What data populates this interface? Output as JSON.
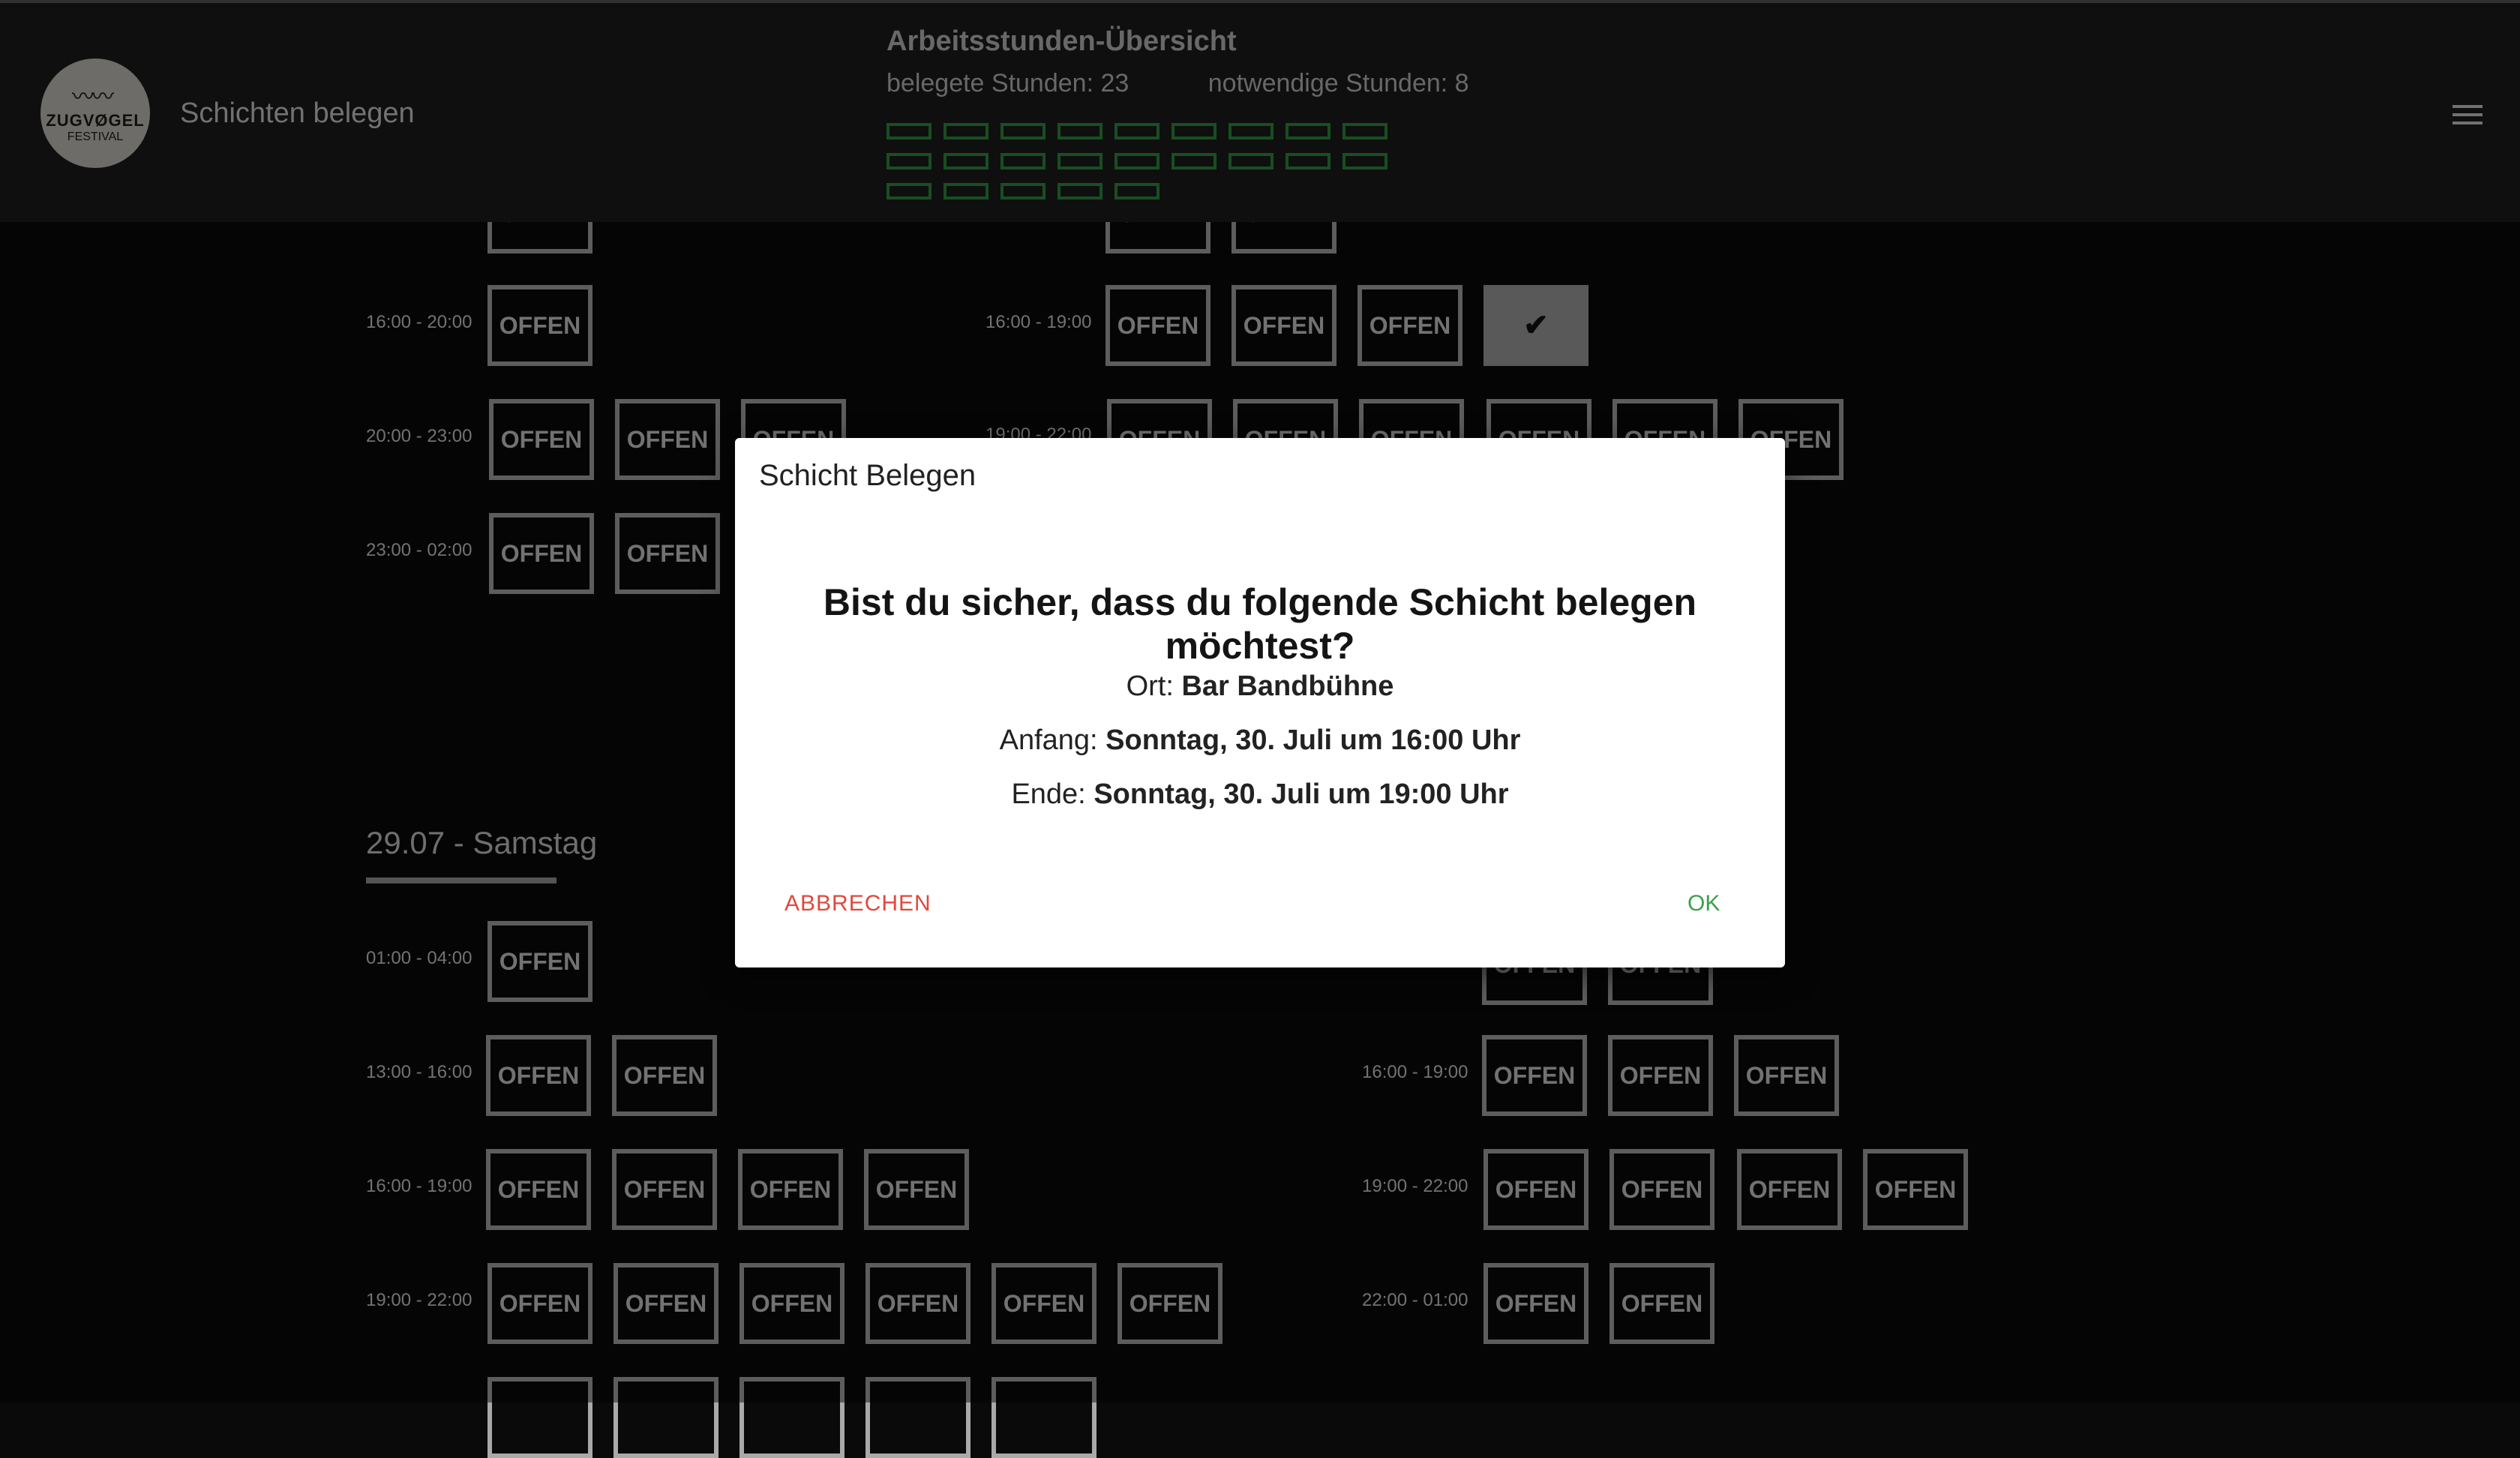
{
  "header": {
    "title": "Schichten belegen",
    "logo_text_1": "ZUGVØGEL",
    "logo_text_2": "FESTIVAL",
    "hours_title": "Arbeitsstunden-Übersicht",
    "booked_hours": "belegete Stunden: 23",
    "required_hours": "notwendige Stunden: 8",
    "hour_blocks_count": 23,
    "block_color": "#2f8f3e"
  },
  "labels": {
    "open": "OFFEN",
    "check": "✔"
  },
  "schedule_top_left": [
    {
      "time": "16:00 - 20:00"
    },
    {
      "time": "20:00 - 23:00"
    },
    {
      "time": "23:00 - 02:00"
    }
  ],
  "schedule_top_right": [
    {
      "time": "16:00 - 19:00"
    },
    {
      "time": "19:00 - 22:00"
    }
  ],
  "day2": {
    "title": "29.07 - Samstag",
    "left": [
      {
        "time": "01:00 - 04:00"
      },
      {
        "time": "13:00 - 16:00"
      },
      {
        "time": "16:00 - 19:00"
      },
      {
        "time": "19:00 - 22:00"
      }
    ],
    "right": [
      {
        "time": "16:00 - 19:00"
      },
      {
        "time": "19:00 - 22:00"
      },
      {
        "time": "22:00 - 01:00"
      }
    ]
  },
  "dialog": {
    "title": "Schicht Belegen",
    "question": "Bist du sicher, dass du folgende Schicht belegen möchtest?",
    "ort_label": "Ort: ",
    "ort_value": "Bar Bandbühne",
    "anfang_label": "Anfang: ",
    "anfang_value": "Sonntag, 30. Juli um 16:00 Uhr",
    "ende_label": "Ende: ",
    "ende_value": "Sonntag, 30. Juli um 19:00 Uhr",
    "cancel_label": "ABBRECHEN",
    "ok_label": "OK",
    "cancel_color": "#e0483d",
    "ok_color": "#39a14a"
  }
}
